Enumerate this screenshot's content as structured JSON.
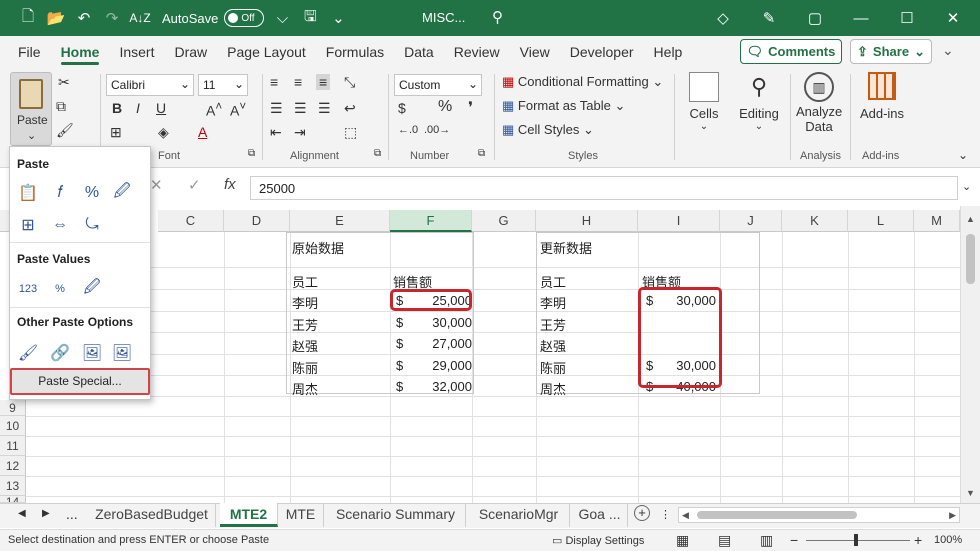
{
  "titlebar": {
    "autosave_label": "AutoSave",
    "autosave_state": "Off",
    "doc_title": "MISC..."
  },
  "menu": {
    "tabs": [
      "File",
      "Home",
      "Insert",
      "Draw",
      "Page Layout",
      "Formulas",
      "Data",
      "Review",
      "View",
      "Developer",
      "Help"
    ],
    "comments": "Comments",
    "share": "Share"
  },
  "ribbon": {
    "paste": "Paste",
    "font_name": "Calibri",
    "font_size": "11",
    "number_format": "Custom",
    "conditional_formatting": "Conditional Formatting",
    "format_as_table": "Format as Table",
    "cell_styles": "Cell Styles",
    "cells": "Cells",
    "editing": "Editing",
    "analyze_data_1": "Analyze",
    "analyze_data_2": "Data",
    "addins": "Add-ins",
    "groups": {
      "font": "Font",
      "alignment": "Alignment",
      "number": "Number",
      "styles": "Styles",
      "analysis": "Analysis",
      "addins": "Add-ins"
    }
  },
  "formula_bar": {
    "fx": "fx",
    "value": "25000"
  },
  "paste_menu": {
    "section_paste": "Paste",
    "section_values": "Paste Values",
    "section_other": "Other Paste Options",
    "paste_special": "Paste Special..."
  },
  "grid": {
    "columns": [
      "C",
      "D",
      "E",
      "F",
      "G",
      "H",
      "I",
      "J",
      "K",
      "L",
      "M"
    ],
    "rows": [
      "9",
      "10",
      "11",
      "12",
      "13",
      "14"
    ],
    "left_table": {
      "title": "原始数据",
      "col1": "员工",
      "col2": "销售额",
      "names": [
        "李明",
        "王芳",
        "赵强",
        "陈丽",
        "周杰"
      ],
      "currency": "$",
      "sales": [
        "25,000",
        "30,000",
        "27,000",
        "29,000",
        "32,000"
      ]
    },
    "right_table": {
      "title": "更新数据",
      "col1": "员工",
      "col2": "销售额",
      "names": [
        "李明",
        "王芳",
        "赵强",
        "陈丽",
        "周杰"
      ],
      "currency": "$",
      "sales": [
        "30,000",
        "",
        "",
        "30,000",
        "40,000"
      ]
    }
  },
  "sheets": {
    "nav_more": "...",
    "tabs": [
      "ZeroBasedBudget",
      "MTE2",
      "MTE",
      "Scenario Summary",
      "ScenarioMgr",
      "Goa ..."
    ]
  },
  "status": {
    "message": "Select destination and press ENTER or choose Paste",
    "display_settings": "Display Settings",
    "zoom": "100%"
  },
  "colors": {
    "brand": "#217346",
    "highlight_box": "#c9252e"
  }
}
